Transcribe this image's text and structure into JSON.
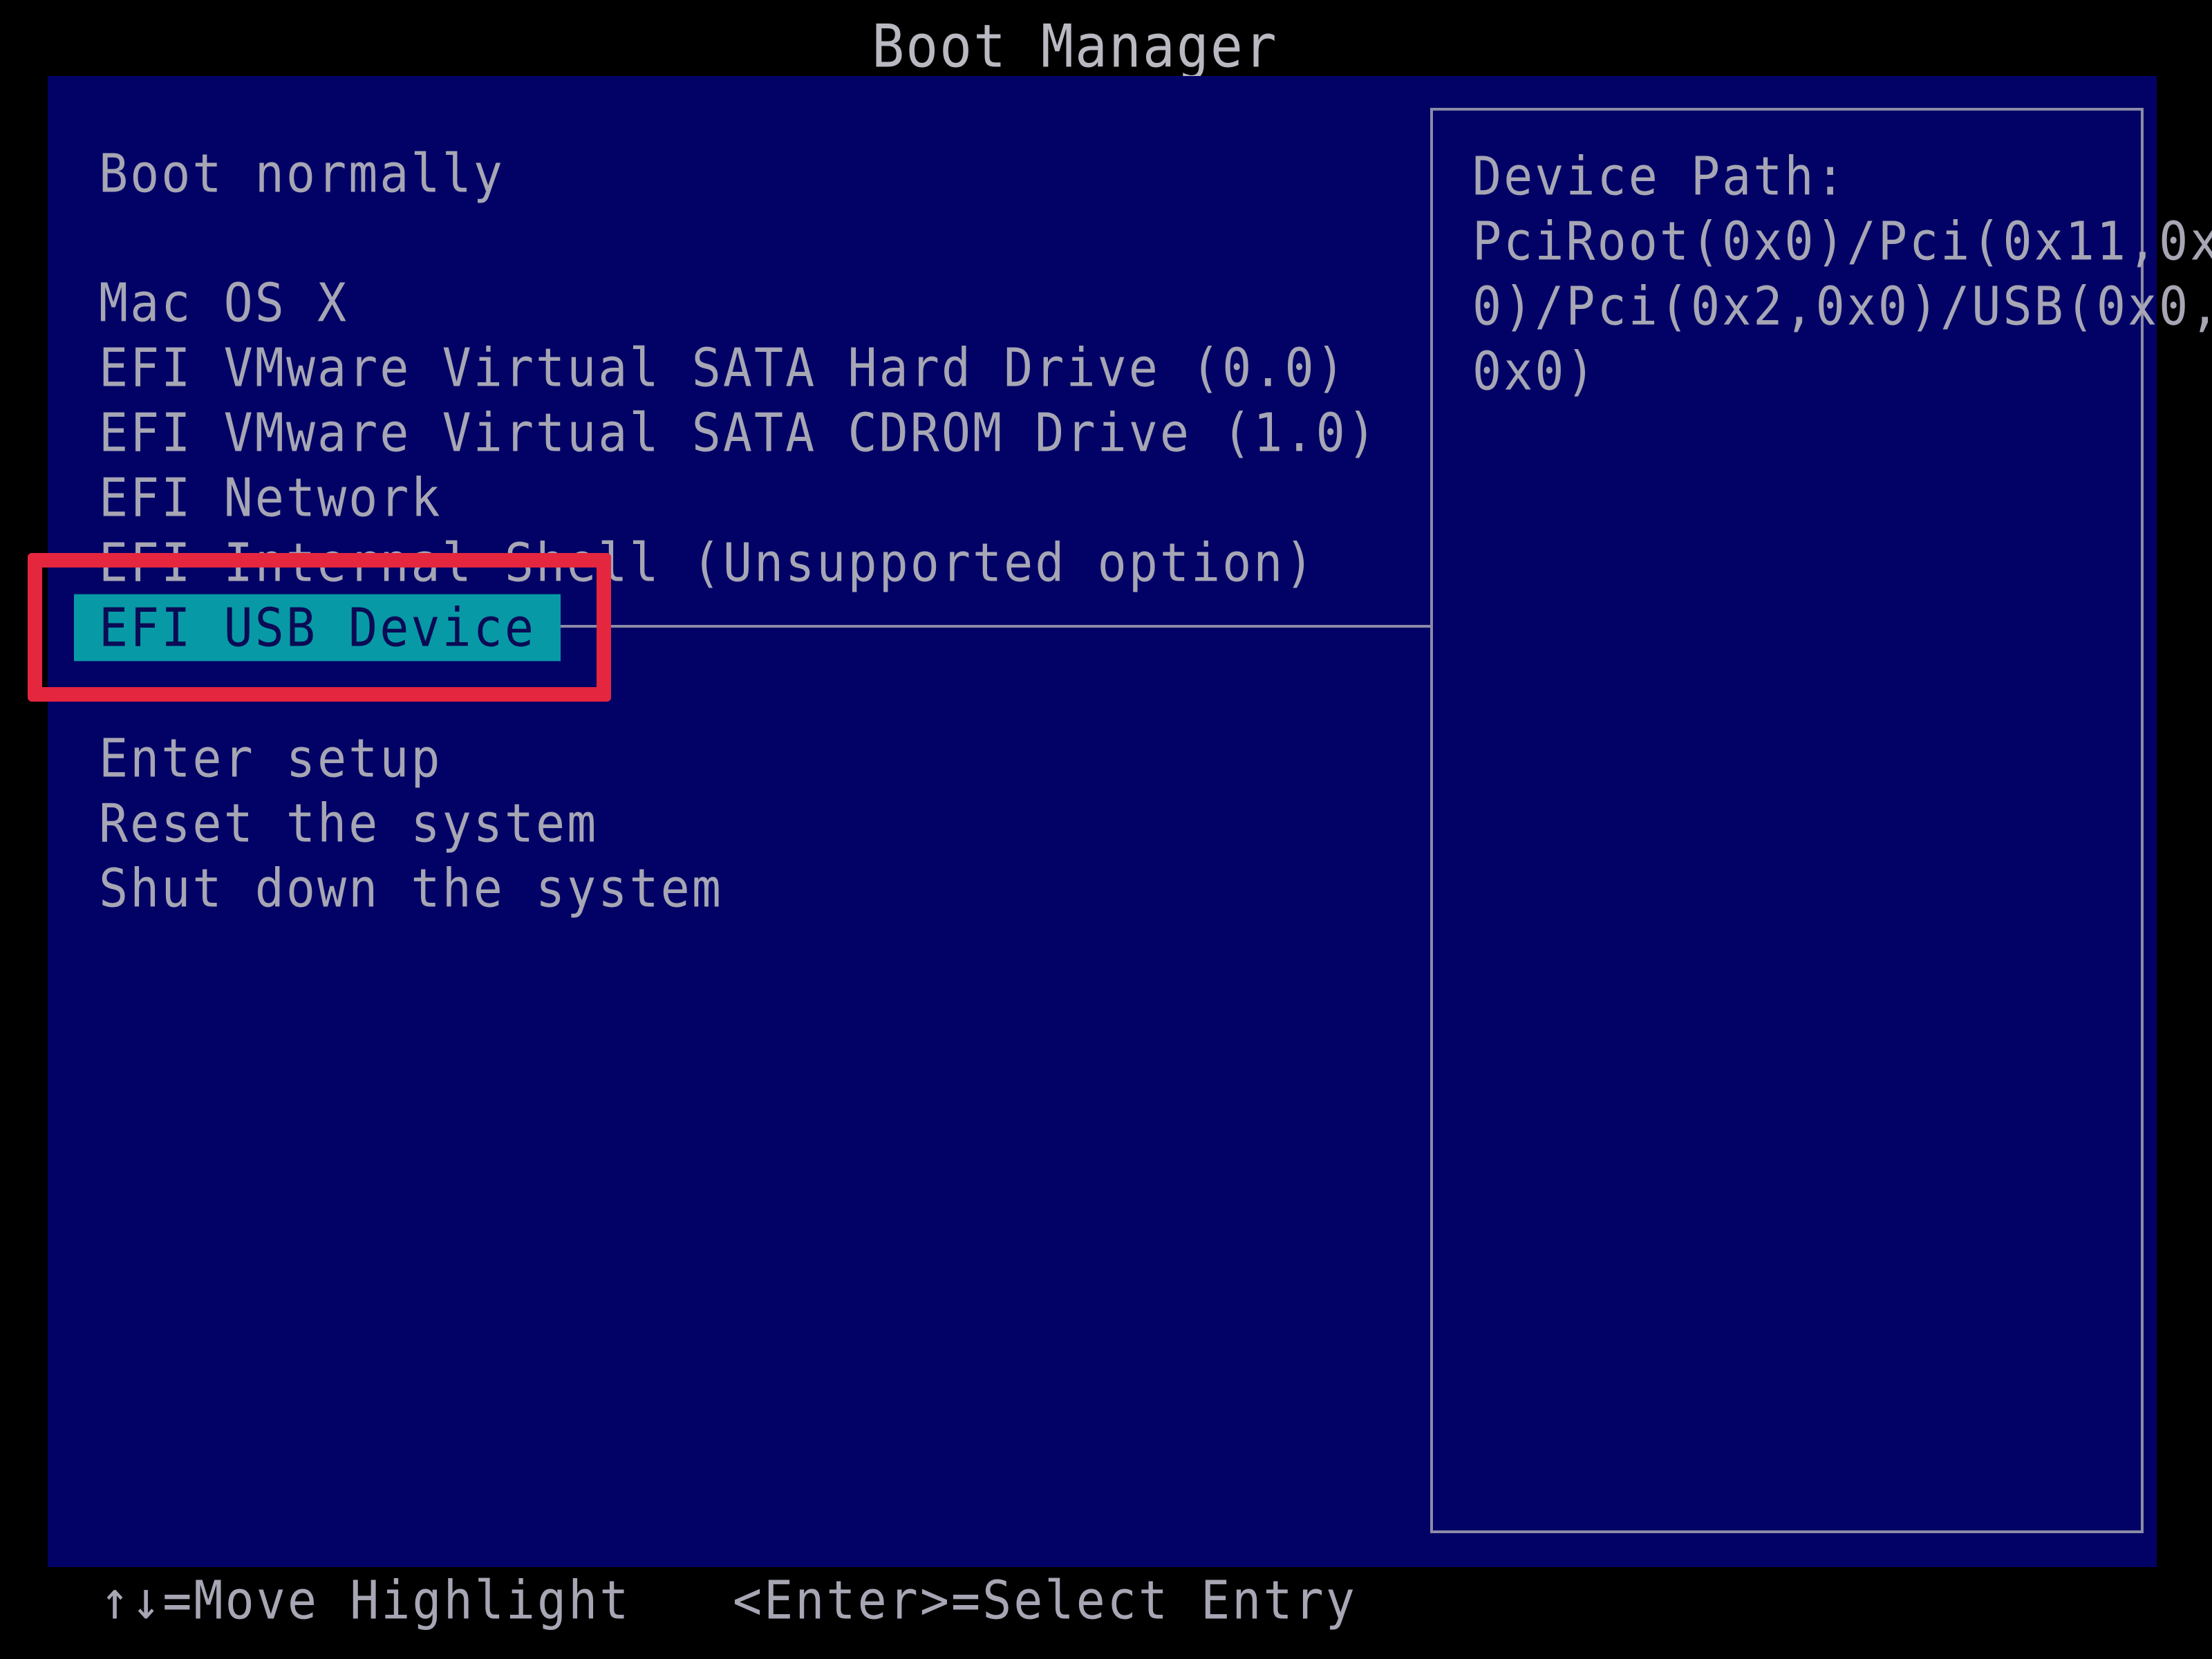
{
  "header": {
    "title": "Boot Manager"
  },
  "menu": {
    "items": [
      {
        "label": "Boot normally",
        "selected": false
      },
      {
        "label": "Mac OS X",
        "selected": false
      },
      {
        "label": "EFI VMware Virtual SATA Hard Drive (0.0)",
        "selected": false
      },
      {
        "label": "EFI VMware Virtual SATA CDROM Drive (1.0)",
        "selected": false
      },
      {
        "label": "EFI Network",
        "selected": false
      },
      {
        "label": "EFI Internal Shell (Unsupported option)",
        "selected": false
      },
      {
        "label": "EFI USB Device",
        "selected": true
      },
      {
        "label": "Enter setup",
        "selected": false
      },
      {
        "label": "Reset the system",
        "selected": false
      },
      {
        "label": "Shut down the system",
        "selected": false
      }
    ]
  },
  "info": {
    "label": "Device Path:",
    "path_lines": [
      "PciRoot(0x0)/Pci(0x11,0x",
      "0)/Pci(0x2,0x0)/USB(0x0,",
      "0x0)"
    ]
  },
  "footer": {
    "move_hint": "↑↓=Move Highlight",
    "select_hint": "<Enter>=Select Entry"
  },
  "colors": {
    "panel_background": "#020266",
    "selection_background": "#079aa6",
    "highlight_annotation": "#e5263f",
    "text": "#a6a6b4"
  }
}
